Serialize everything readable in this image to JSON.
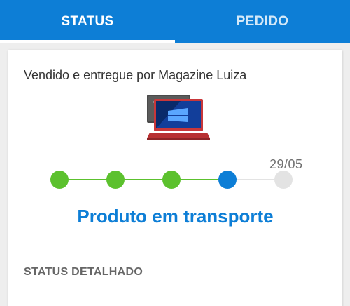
{
  "tabs": [
    {
      "label": "STATUS",
      "active": true
    },
    {
      "label": "PEDIDO",
      "active": false
    }
  ],
  "card": {
    "seller": "Vendido e entregue por Magazine Luiza",
    "product_image": "laptop-product-image",
    "steps": [
      {
        "state": "done",
        "color": "#5cc12e"
      },
      {
        "state": "done",
        "color": "#5cc12e"
      },
      {
        "state": "done",
        "color": "#5cc12e"
      },
      {
        "state": "current",
        "color": "#0d7ed6"
      },
      {
        "state": "pending",
        "color": "#e3e3e3",
        "date": "29/05"
      }
    ],
    "status": "Produto em transporte",
    "detail_label": "STATUS DETALHADO"
  },
  "colors": {
    "brand_blue": "#0d7ed6",
    "done_green": "#5cc12e",
    "pending_gray": "#e3e3e3"
  }
}
